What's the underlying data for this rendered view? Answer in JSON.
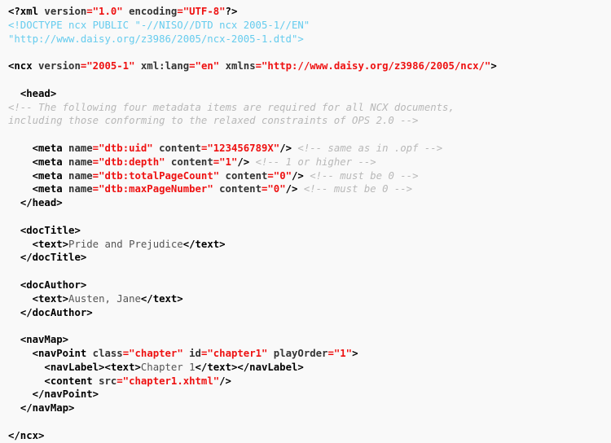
{
  "document": {
    "kind": "xml-source-listing",
    "language": "XML",
    "description": "NCX (Navigation Control file for XML) example for an EPUB publication",
    "background_color": "#f9f9f9",
    "colors": {
      "tag": "#000000",
      "attribute_name": "#333333",
      "attribute_value": "#ee1111",
      "doctype": "#66ccee",
      "comment": "#b8b8b8",
      "text_content": "#555555"
    }
  },
  "lines": [
    {
      "n": 1,
      "indent": 0,
      "tokens": [
        {
          "t": "tag",
          "s": "<?xml "
        },
        {
          "t": "attr",
          "s": "version"
        },
        {
          "t": "val",
          "s": "=\"1.0\""
        },
        {
          "t": "attr",
          "s": " encoding"
        },
        {
          "t": "val",
          "s": "=\"UTF-8\""
        },
        {
          "t": "tag",
          "s": "?>"
        }
      ]
    },
    {
      "n": 2,
      "indent": 0,
      "tokens": [
        {
          "t": "doctype",
          "s": "<!DOCTYPE ncx PUBLIC \"-//NISO//DTD ncx 2005-1//EN\""
        }
      ]
    },
    {
      "n": 3,
      "indent": 0,
      "tokens": [
        {
          "t": "doctype",
          "s": "\"http://www.daisy.org/z3986/2005/ncx-2005-1.dtd\">"
        }
      ]
    },
    {
      "n": 4,
      "indent": 0,
      "tokens": []
    },
    {
      "n": 5,
      "indent": 0,
      "tokens": [
        {
          "t": "tag",
          "s": "<ncx "
        },
        {
          "t": "attr",
          "s": "version"
        },
        {
          "t": "val",
          "s": "=\"2005-1\""
        },
        {
          "t": "attr",
          "s": " xml:lang"
        },
        {
          "t": "val",
          "s": "=\"en\""
        },
        {
          "t": "attr",
          "s": " xmlns"
        },
        {
          "t": "val",
          "s": "=\"http://www.daisy.org/z3986/2005/ncx/\""
        },
        {
          "t": "tag",
          "s": ">"
        }
      ]
    },
    {
      "n": 6,
      "indent": 0,
      "tokens": []
    },
    {
      "n": 7,
      "indent": 2,
      "tokens": [
        {
          "t": "tag",
          "s": "<head>"
        }
      ]
    },
    {
      "n": 8,
      "indent": 0,
      "tokens": [
        {
          "t": "comment",
          "s": "<!-- The following four metadata items are required for all NCX documents,"
        }
      ]
    },
    {
      "n": 9,
      "indent": 0,
      "tokens": [
        {
          "t": "comment",
          "s": "including those conforming to the relaxed constraints of OPS 2.0 -->"
        }
      ]
    },
    {
      "n": 10,
      "indent": 0,
      "tokens": []
    },
    {
      "n": 11,
      "indent": 4,
      "tokens": [
        {
          "t": "tag",
          "s": "<meta "
        },
        {
          "t": "attr",
          "s": "name"
        },
        {
          "t": "val",
          "s": "=\"dtb:uid\""
        },
        {
          "t": "attr",
          "s": " content"
        },
        {
          "t": "val",
          "s": "=\"123456789X\""
        },
        {
          "t": "tag",
          "s": "/>"
        },
        {
          "t": "comment",
          "s": " <!-- same as in .opf -->"
        }
      ]
    },
    {
      "n": 12,
      "indent": 4,
      "tokens": [
        {
          "t": "tag",
          "s": "<meta "
        },
        {
          "t": "attr",
          "s": "name"
        },
        {
          "t": "val",
          "s": "=\"dtb:depth\""
        },
        {
          "t": "attr",
          "s": " content"
        },
        {
          "t": "val",
          "s": "=\"1\""
        },
        {
          "t": "tag",
          "s": "/>"
        },
        {
          "t": "comment",
          "s": " <!-- 1 or higher -->"
        }
      ]
    },
    {
      "n": 13,
      "indent": 4,
      "tokens": [
        {
          "t": "tag",
          "s": "<meta "
        },
        {
          "t": "attr",
          "s": "name"
        },
        {
          "t": "val",
          "s": "=\"dtb:totalPageCount\""
        },
        {
          "t": "attr",
          "s": " content"
        },
        {
          "t": "val",
          "s": "=\"0\""
        },
        {
          "t": "tag",
          "s": "/>"
        },
        {
          "t": "comment",
          "s": " <!-- must be 0 -->"
        }
      ]
    },
    {
      "n": 14,
      "indent": 4,
      "tokens": [
        {
          "t": "tag",
          "s": "<meta "
        },
        {
          "t": "attr",
          "s": "name"
        },
        {
          "t": "val",
          "s": "=\"dtb:maxPageNumber\""
        },
        {
          "t": "attr",
          "s": " content"
        },
        {
          "t": "val",
          "s": "=\"0\""
        },
        {
          "t": "tag",
          "s": "/>"
        },
        {
          "t": "comment",
          "s": " <!-- must be 0 -->"
        }
      ]
    },
    {
      "n": 15,
      "indent": 2,
      "tokens": [
        {
          "t": "tag",
          "s": "</head>"
        }
      ]
    },
    {
      "n": 16,
      "indent": 0,
      "tokens": []
    },
    {
      "n": 17,
      "indent": 2,
      "tokens": [
        {
          "t": "tag",
          "s": "<docTitle>"
        }
      ]
    },
    {
      "n": 18,
      "indent": 4,
      "tokens": [
        {
          "t": "tag",
          "s": "<text>"
        },
        {
          "t": "txt",
          "s": "Pride and Prejudice"
        },
        {
          "t": "tag",
          "s": "</text>"
        }
      ]
    },
    {
      "n": 19,
      "indent": 2,
      "tokens": [
        {
          "t": "tag",
          "s": "</docTitle>"
        }
      ]
    },
    {
      "n": 20,
      "indent": 0,
      "tokens": []
    },
    {
      "n": 21,
      "indent": 2,
      "tokens": [
        {
          "t": "tag",
          "s": "<docAuthor>"
        }
      ]
    },
    {
      "n": 22,
      "indent": 4,
      "tokens": [
        {
          "t": "tag",
          "s": "<text>"
        },
        {
          "t": "txt",
          "s": "Austen, Jane"
        },
        {
          "t": "tag",
          "s": "</text>"
        }
      ]
    },
    {
      "n": 23,
      "indent": 2,
      "tokens": [
        {
          "t": "tag",
          "s": "</docAuthor>"
        }
      ]
    },
    {
      "n": 24,
      "indent": 0,
      "tokens": []
    },
    {
      "n": 25,
      "indent": 2,
      "tokens": [
        {
          "t": "tag",
          "s": "<navMap>"
        }
      ]
    },
    {
      "n": 26,
      "indent": 4,
      "tokens": [
        {
          "t": "tag",
          "s": "<navPoint "
        },
        {
          "t": "attr",
          "s": "class"
        },
        {
          "t": "val",
          "s": "=\"chapter\""
        },
        {
          "t": "attr",
          "s": " id"
        },
        {
          "t": "val",
          "s": "=\"chapter1\""
        },
        {
          "t": "attr",
          "s": " playOrder"
        },
        {
          "t": "val",
          "s": "=\"1\""
        },
        {
          "t": "tag",
          "s": ">"
        }
      ]
    },
    {
      "n": 27,
      "indent": 6,
      "tokens": [
        {
          "t": "tag",
          "s": "<navLabel><text>"
        },
        {
          "t": "txt",
          "s": "Chapter 1"
        },
        {
          "t": "tag",
          "s": "</text></navLabel>"
        }
      ]
    },
    {
      "n": 28,
      "indent": 6,
      "tokens": [
        {
          "t": "tag",
          "s": "<content "
        },
        {
          "t": "attr",
          "s": "src"
        },
        {
          "t": "val",
          "s": "=\"chapter1.xhtml\""
        },
        {
          "t": "tag",
          "s": "/>"
        }
      ]
    },
    {
      "n": 29,
      "indent": 4,
      "tokens": [
        {
          "t": "tag",
          "s": "</navPoint>"
        }
      ]
    },
    {
      "n": 30,
      "indent": 2,
      "tokens": [
        {
          "t": "tag",
          "s": "</navMap>"
        }
      ]
    },
    {
      "n": 31,
      "indent": 0,
      "tokens": []
    },
    {
      "n": 32,
      "indent": 0,
      "tokens": [
        {
          "t": "tag",
          "s": "</ncx>"
        }
      ]
    }
  ]
}
